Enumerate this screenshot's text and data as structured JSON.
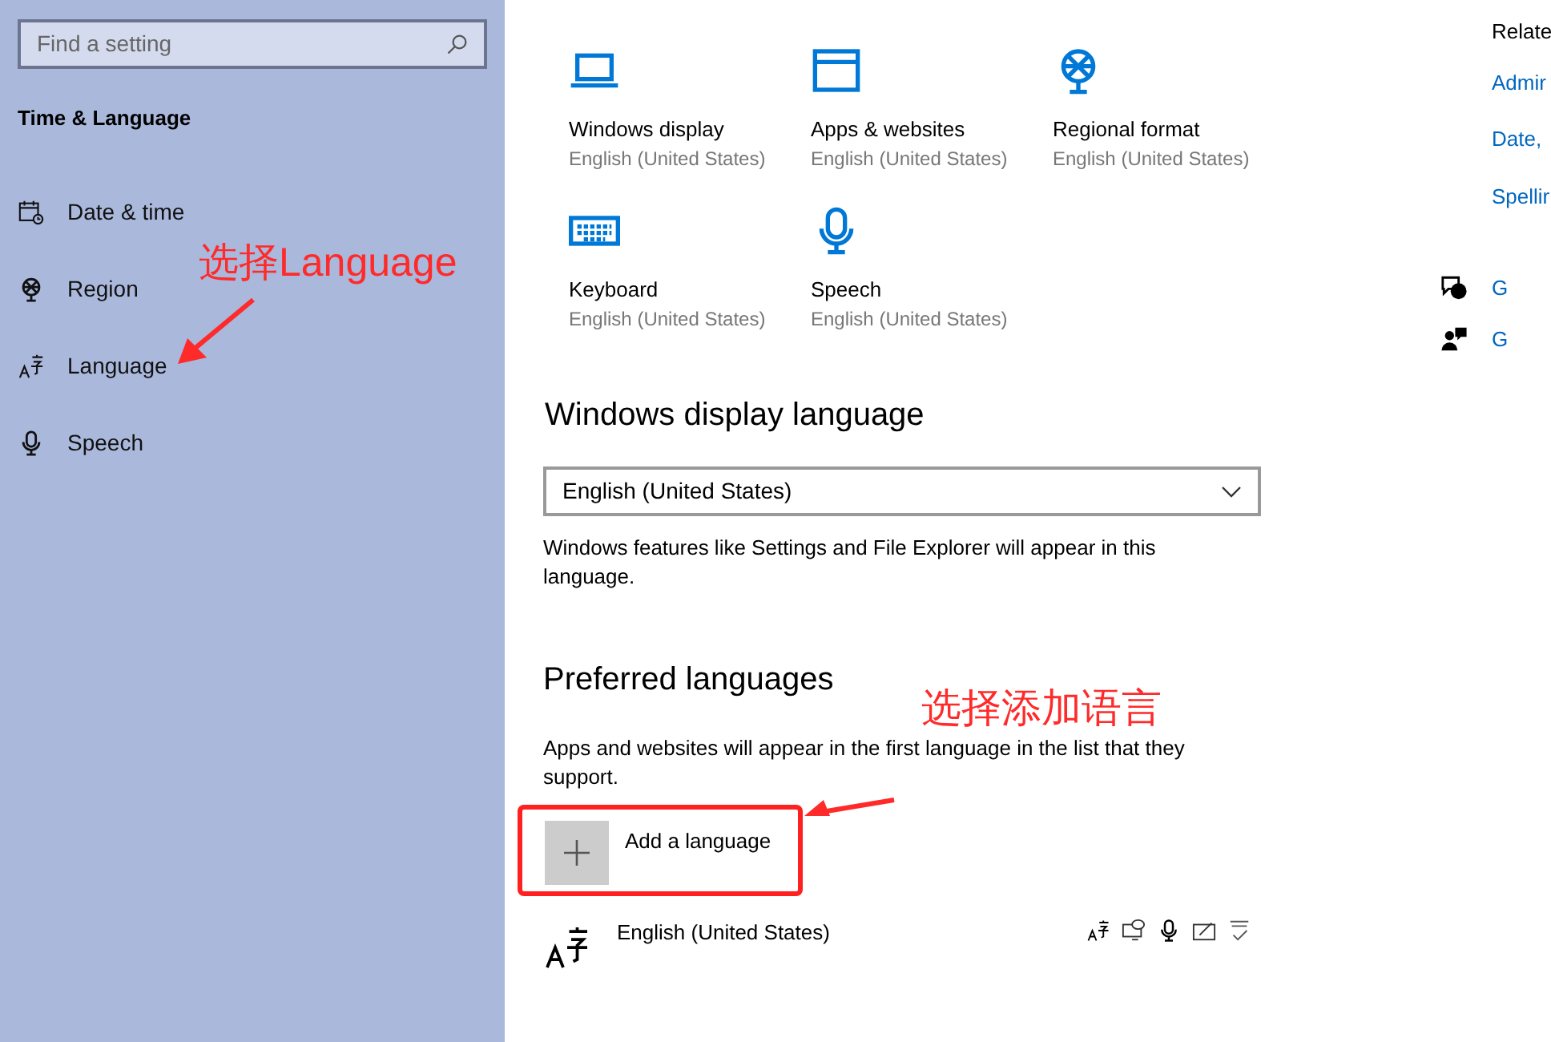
{
  "sidebar": {
    "search": {
      "placeholder": "Find a setting"
    },
    "title": "Time & Language",
    "items": [
      {
        "kind": "calendar",
        "label": "Date & time"
      },
      {
        "kind": "globe",
        "label": "Region"
      },
      {
        "kind": "language",
        "label": "Language"
      },
      {
        "kind": "mic",
        "label": "Speech"
      }
    ]
  },
  "tiles": [
    {
      "kind": "laptop",
      "title": "Windows display",
      "subtitle": "English (United States)"
    },
    {
      "kind": "window",
      "title": "Apps & websites",
      "subtitle": "English (United States)"
    },
    {
      "kind": "globe",
      "title": "Regional format",
      "subtitle": "English (United States)"
    },
    {
      "kind": "keyboard",
      "title": "Keyboard",
      "subtitle": "English (United States)"
    },
    {
      "kind": "mic",
      "title": "Speech",
      "subtitle": "English (United States)"
    }
  ],
  "display_language": {
    "heading": "Windows display language",
    "value": "English (United States)",
    "description": "Windows features like Settings and File Explorer will appear in this language."
  },
  "preferred": {
    "heading": "Preferred languages",
    "description": "Apps and websites will appear in the first language in the list that they support.",
    "add_label": "Add a language",
    "languages": [
      {
        "name": "English (United States)"
      }
    ]
  },
  "related": {
    "heading": "Relate",
    "links": [
      "Admir",
      "Date, ",
      "Spellir"
    ],
    "help": [
      {
        "kind": "help",
        "label": "G"
      },
      {
        "kind": "feedback",
        "label": "G"
      }
    ]
  },
  "annotations": [
    {
      "text": "选择Language"
    },
    {
      "text": "选择添加语言"
    }
  ]
}
